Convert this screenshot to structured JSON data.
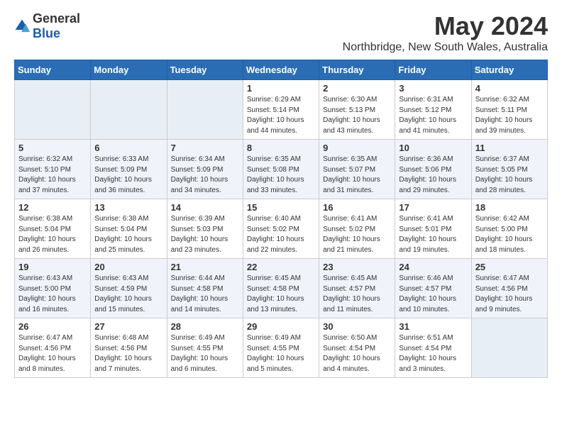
{
  "app": {
    "name_general": "General",
    "name_blue": "Blue"
  },
  "title": "May 2024",
  "location": "Northbridge, New South Wales, Australia",
  "days_of_week": [
    "Sunday",
    "Monday",
    "Tuesday",
    "Wednesday",
    "Thursday",
    "Friday",
    "Saturday"
  ],
  "weeks": [
    [
      {
        "day": "",
        "detail": ""
      },
      {
        "day": "",
        "detail": ""
      },
      {
        "day": "",
        "detail": ""
      },
      {
        "day": "1",
        "detail": "Sunrise: 6:29 AM\nSunset: 5:14 PM\nDaylight: 10 hours\nand 44 minutes."
      },
      {
        "day": "2",
        "detail": "Sunrise: 6:30 AM\nSunset: 5:13 PM\nDaylight: 10 hours\nand 43 minutes."
      },
      {
        "day": "3",
        "detail": "Sunrise: 6:31 AM\nSunset: 5:12 PM\nDaylight: 10 hours\nand 41 minutes."
      },
      {
        "day": "4",
        "detail": "Sunrise: 6:32 AM\nSunset: 5:11 PM\nDaylight: 10 hours\nand 39 minutes."
      }
    ],
    [
      {
        "day": "5",
        "detail": "Sunrise: 6:32 AM\nSunset: 5:10 PM\nDaylight: 10 hours\nand 37 minutes."
      },
      {
        "day": "6",
        "detail": "Sunrise: 6:33 AM\nSunset: 5:09 PM\nDaylight: 10 hours\nand 36 minutes."
      },
      {
        "day": "7",
        "detail": "Sunrise: 6:34 AM\nSunset: 5:09 PM\nDaylight: 10 hours\nand 34 minutes."
      },
      {
        "day": "8",
        "detail": "Sunrise: 6:35 AM\nSunset: 5:08 PM\nDaylight: 10 hours\nand 33 minutes."
      },
      {
        "day": "9",
        "detail": "Sunrise: 6:35 AM\nSunset: 5:07 PM\nDaylight: 10 hours\nand 31 minutes."
      },
      {
        "day": "10",
        "detail": "Sunrise: 6:36 AM\nSunset: 5:06 PM\nDaylight: 10 hours\nand 29 minutes."
      },
      {
        "day": "11",
        "detail": "Sunrise: 6:37 AM\nSunset: 5:05 PM\nDaylight: 10 hours\nand 28 minutes."
      }
    ],
    [
      {
        "day": "12",
        "detail": "Sunrise: 6:38 AM\nSunset: 5:04 PM\nDaylight: 10 hours\nand 26 minutes."
      },
      {
        "day": "13",
        "detail": "Sunrise: 6:38 AM\nSunset: 5:04 PM\nDaylight: 10 hours\nand 25 minutes."
      },
      {
        "day": "14",
        "detail": "Sunrise: 6:39 AM\nSunset: 5:03 PM\nDaylight: 10 hours\nand 23 minutes."
      },
      {
        "day": "15",
        "detail": "Sunrise: 6:40 AM\nSunset: 5:02 PM\nDaylight: 10 hours\nand 22 minutes."
      },
      {
        "day": "16",
        "detail": "Sunrise: 6:41 AM\nSunset: 5:02 PM\nDaylight: 10 hours\nand 21 minutes."
      },
      {
        "day": "17",
        "detail": "Sunrise: 6:41 AM\nSunset: 5:01 PM\nDaylight: 10 hours\nand 19 minutes."
      },
      {
        "day": "18",
        "detail": "Sunrise: 6:42 AM\nSunset: 5:00 PM\nDaylight: 10 hours\nand 18 minutes."
      }
    ],
    [
      {
        "day": "19",
        "detail": "Sunrise: 6:43 AM\nSunset: 5:00 PM\nDaylight: 10 hours\nand 16 minutes."
      },
      {
        "day": "20",
        "detail": "Sunrise: 6:43 AM\nSunset: 4:59 PM\nDaylight: 10 hours\nand 15 minutes."
      },
      {
        "day": "21",
        "detail": "Sunrise: 6:44 AM\nSunset: 4:58 PM\nDaylight: 10 hours\nand 14 minutes."
      },
      {
        "day": "22",
        "detail": "Sunrise: 6:45 AM\nSunset: 4:58 PM\nDaylight: 10 hours\nand 13 minutes."
      },
      {
        "day": "23",
        "detail": "Sunrise: 6:45 AM\nSunset: 4:57 PM\nDaylight: 10 hours\nand 11 minutes."
      },
      {
        "day": "24",
        "detail": "Sunrise: 6:46 AM\nSunset: 4:57 PM\nDaylight: 10 hours\nand 10 minutes."
      },
      {
        "day": "25",
        "detail": "Sunrise: 6:47 AM\nSunset: 4:56 PM\nDaylight: 10 hours\nand 9 minutes."
      }
    ],
    [
      {
        "day": "26",
        "detail": "Sunrise: 6:47 AM\nSunset: 4:56 PM\nDaylight: 10 hours\nand 8 minutes."
      },
      {
        "day": "27",
        "detail": "Sunrise: 6:48 AM\nSunset: 4:56 PM\nDaylight: 10 hours\nand 7 minutes."
      },
      {
        "day": "28",
        "detail": "Sunrise: 6:49 AM\nSunset: 4:55 PM\nDaylight: 10 hours\nand 6 minutes."
      },
      {
        "day": "29",
        "detail": "Sunrise: 6:49 AM\nSunset: 4:55 PM\nDaylight: 10 hours\nand 5 minutes."
      },
      {
        "day": "30",
        "detail": "Sunrise: 6:50 AM\nSunset: 4:54 PM\nDaylight: 10 hours\nand 4 minutes."
      },
      {
        "day": "31",
        "detail": "Sunrise: 6:51 AM\nSunset: 4:54 PM\nDaylight: 10 hours\nand 3 minutes."
      },
      {
        "day": "",
        "detail": ""
      }
    ]
  ]
}
